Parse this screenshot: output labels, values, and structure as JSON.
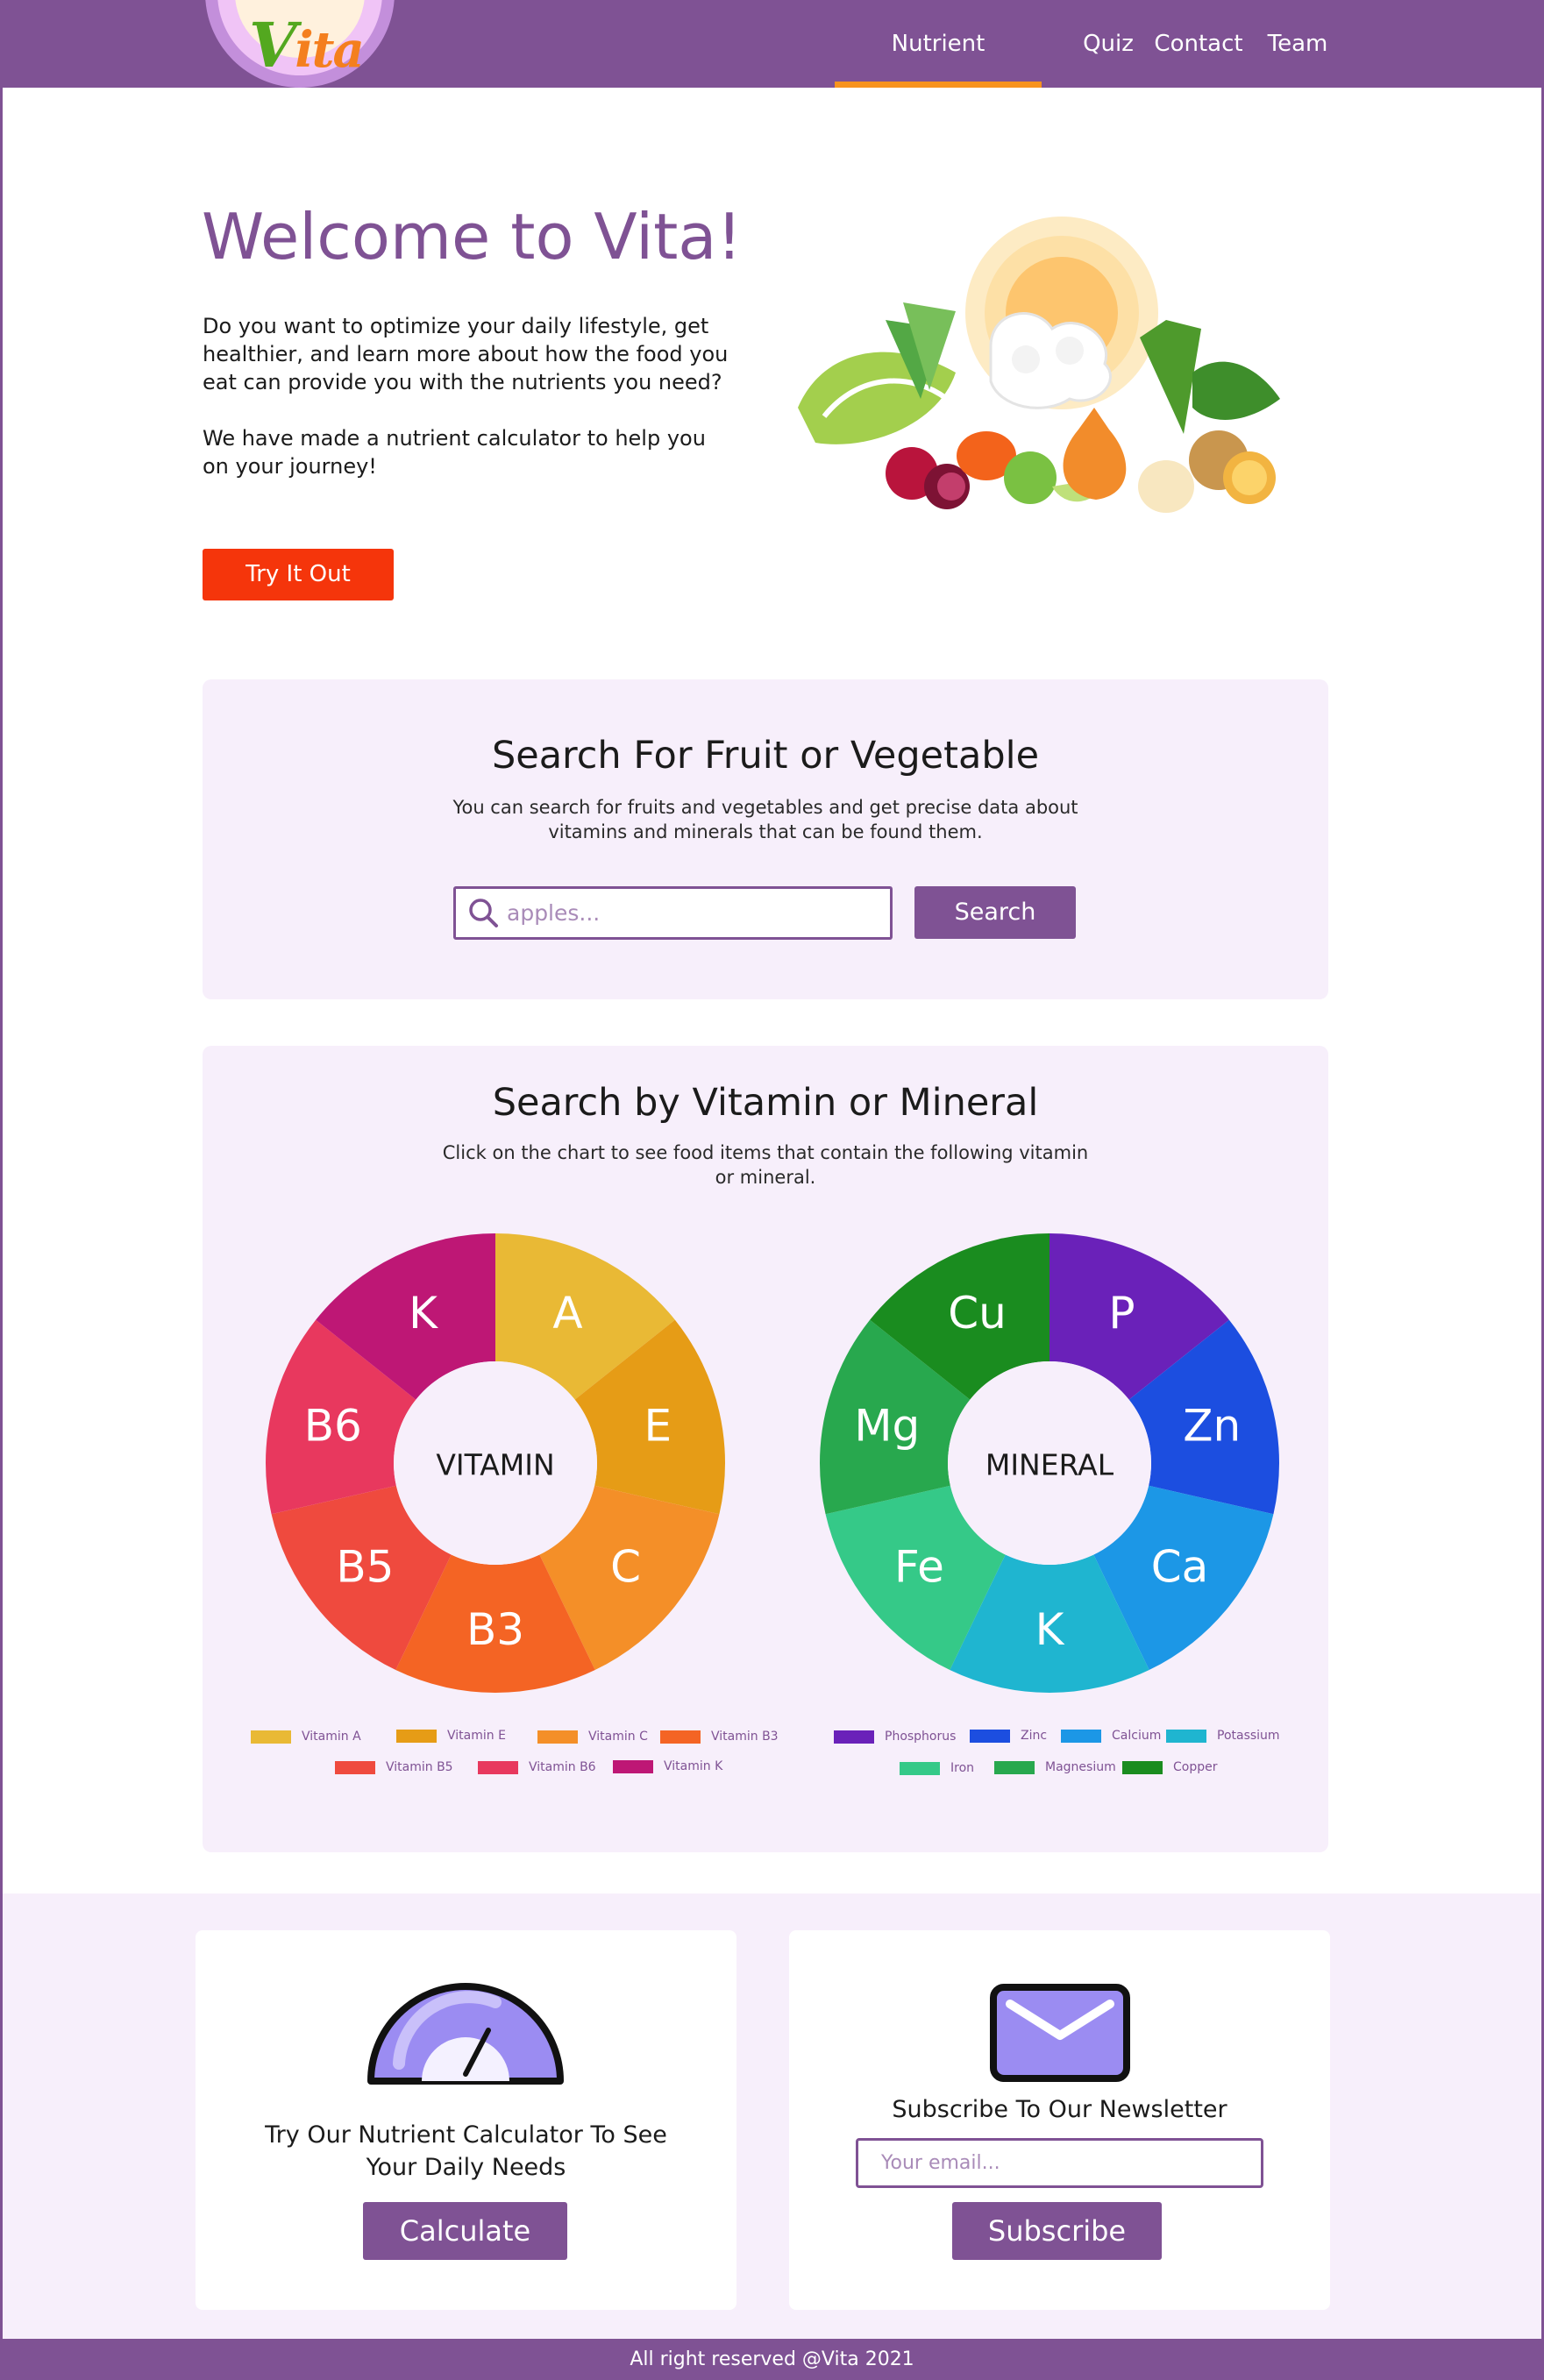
{
  "nav": {
    "logo_v": "V",
    "logo_rest": "ita",
    "links": [
      "Nutrient Calculator",
      "Quiz",
      "Contact",
      "Team"
    ]
  },
  "hero": {
    "title": "Welcome to Vita!",
    "p1": "Do you want to optimize your daily lifestyle, get healthier, and learn more about how the food you eat can provide you with the nutrients you need?",
    "p2": "We have made a nutrient calculator to help you on your journey!",
    "button": "Try It Out"
  },
  "search": {
    "title": "Search For Fruit or Vegetable",
    "subtitle_1": "You can search for fruits and vegetables and get precise data about",
    "subtitle_2": "vitamins and minerals that can be found them.",
    "placeholder": "apples...",
    "button": "Search"
  },
  "nutrients": {
    "title": "Search by Vitamin or Mineral",
    "subtitle_1": "Click on the chart to see food items that contain the following vitamin",
    "subtitle_2": "or mineral.",
    "vitamin": {
      "center": "VITAMIN",
      "segments": [
        {
          "label": "A",
          "name": "Vitamin A",
          "color": "#e9b935"
        },
        {
          "label": "E",
          "name": "Vitamin E",
          "color": "#e69c16"
        },
        {
          "label": "C",
          "name": "Vitamin C",
          "color": "#f48f28"
        },
        {
          "label": "B3",
          "name": "Vitamin B3",
          "color": "#f46424"
        },
        {
          "label": "B5",
          "name": "Vitamin B5",
          "color": "#ef4a3e"
        },
        {
          "label": "B6",
          "name": "Vitamin B6",
          "color": "#e8385e"
        },
        {
          "label": "K",
          "name": "Vitamin K",
          "color": "#be1775"
        }
      ]
    },
    "mineral": {
      "center": "MINERAL",
      "segments": [
        {
          "label": "P",
          "name": "Phosphorus",
          "color": "#6a21b9"
        },
        {
          "label": "Zn",
          "name": "Zinc",
          "color": "#1c4ee0"
        },
        {
          "label": "Ca",
          "name": "Calcium",
          "color": "#1c97e6"
        },
        {
          "label": "K",
          "name": "Potassium",
          "color": "#1fb5d0"
        },
        {
          "label": "Fe",
          "name": "Iron",
          "color": "#35c988"
        },
        {
          "label": "Mg",
          "name": "Magnesium",
          "color": "#28a84e"
        },
        {
          "label": "Cu",
          "name": "Copper",
          "color": "#1a8c1f"
        }
      ]
    }
  },
  "calculator": {
    "line1": "Try Our Nutrient Calculator To See",
    "line2": "Your Daily Needs",
    "button": "Calculate"
  },
  "newsletter": {
    "title": "Subscribe To Our Newsletter",
    "placeholder": "Your email...",
    "button": "Subscribe"
  },
  "footer": {
    "text": "All right reserved @Vita 2021"
  }
}
